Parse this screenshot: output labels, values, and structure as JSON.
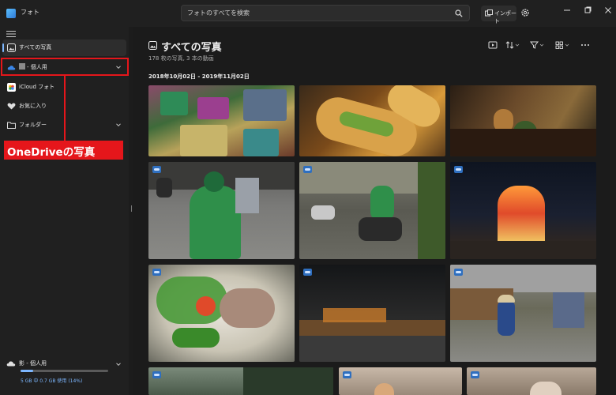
{
  "app": {
    "title": "フォト"
  },
  "search": {
    "placeholder": "フォトのすべてを検索"
  },
  "toolbar": {
    "import_label": "インポート"
  },
  "sidebar": {
    "items": [
      {
        "label": "すべての写真",
        "icon": "photo-icon"
      },
      {
        "label": "- 個人用",
        "icon": "onedrive-cloud-icon"
      },
      {
        "label": "iCloud フォト",
        "icon": "icloud-icon"
      },
      {
        "label": "お気に入り",
        "icon": "heart-icon"
      },
      {
        "label": "フォルダー",
        "icon": "folder-icon"
      }
    ],
    "callout": "OneDriveの写真",
    "storage": {
      "title": "影 - 個人用",
      "usage": "5 GB 中 0.7 GB 使用 (14%)",
      "used_fraction": 0.14
    }
  },
  "main": {
    "title": "すべての写真",
    "subtitle": "178 枚の写真, 3 本の動画",
    "date_range": "2018年10月02日 - 2019年11月02日"
  },
  "colors": {
    "accent": "#7db7ff",
    "highlight_red": "#e5161b",
    "background": "#1b1b1b",
    "sidebar": "#202020"
  }
}
